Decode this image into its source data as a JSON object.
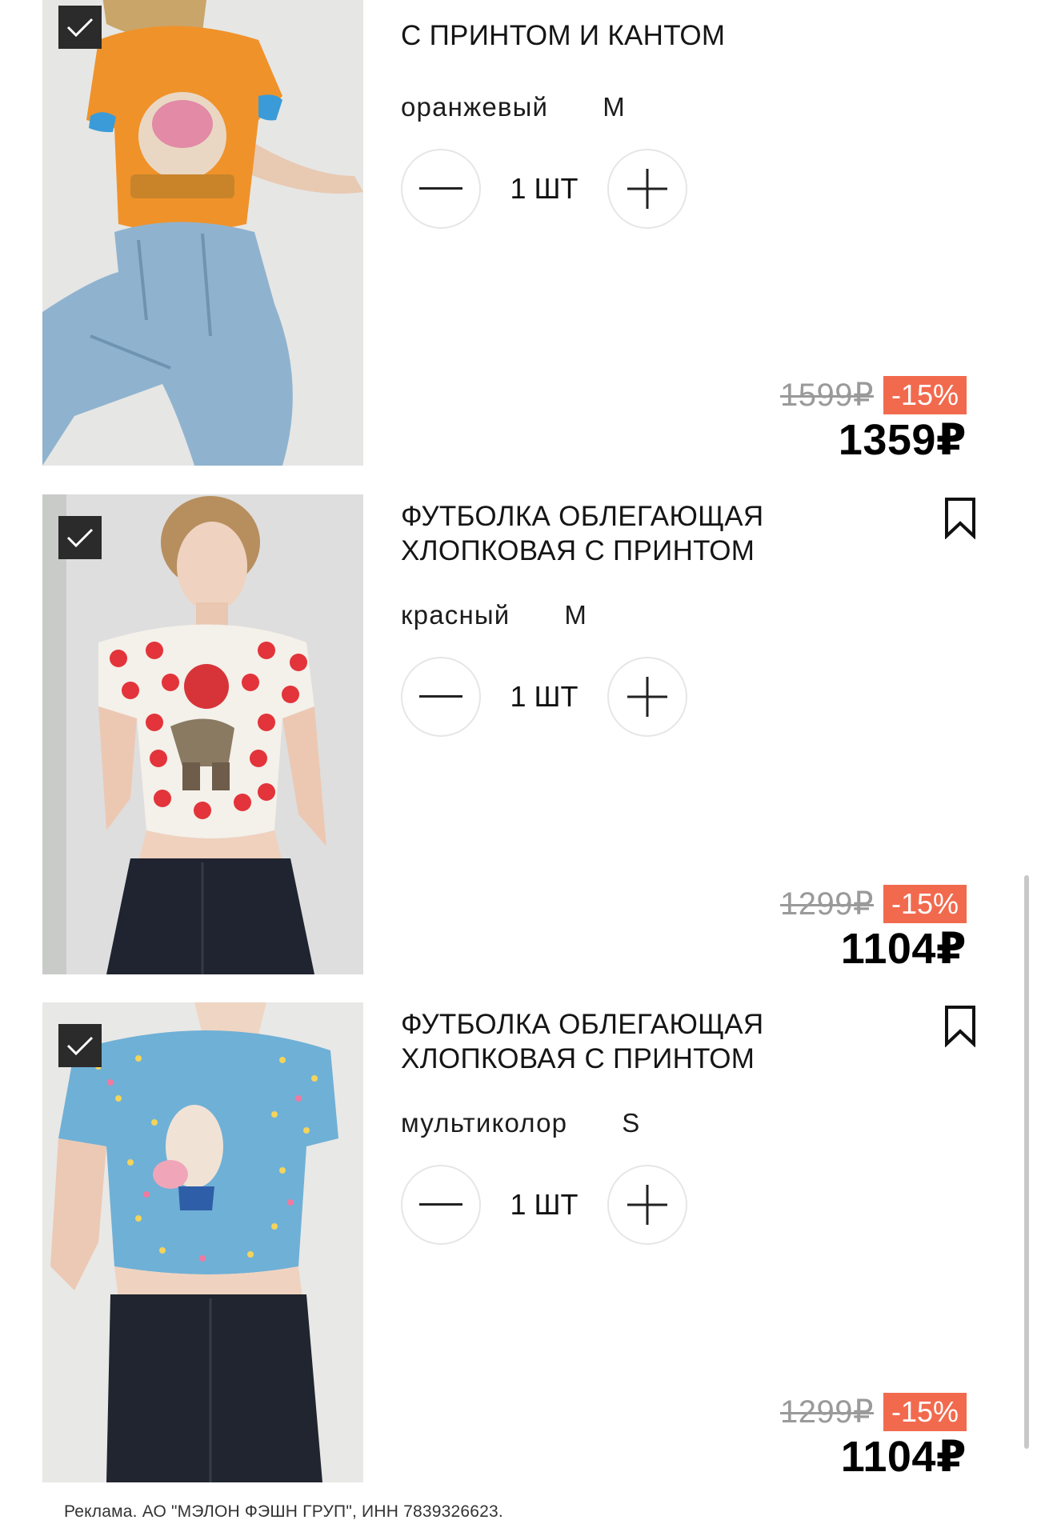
{
  "cart": {
    "items": [
      {
        "title": "С ПРИНТОМ И КАНТОМ",
        "color": "оранжевый",
        "size": "M",
        "quantity": "1 ШТ",
        "old_price": "1599₽",
        "discount": "-15%",
        "price": "1359₽",
        "selected": true,
        "photo_icon": "orange-tshirt-photo"
      },
      {
        "title": "ФУТБОЛКА ОБЛЕГАЮЩАЯ ХЛОПКОВАЯ С ПРИНТОМ",
        "color": "красный",
        "size": "M",
        "quantity": "1 ШТ",
        "old_price": "1299₽",
        "discount": "-15%",
        "price": "1104₽",
        "selected": true,
        "photo_icon": "red-polka-dot-tshirt-photo"
      },
      {
        "title": "ФУТБОЛКА ОБЛЕГАЮЩАЯ ХЛОПКОВАЯ С ПРИНТОМ",
        "color": "мультиколор",
        "size": "S",
        "quantity": "1 ШТ",
        "old_price": "1299₽",
        "discount": "-15%",
        "price": "1104₽",
        "selected": true,
        "photo_icon": "blue-floral-tshirt-photo"
      }
    ]
  },
  "footer": {
    "ad_text": "Реклама. АО \"МЭЛОН ФЭШН ГРУП\", ИНН 7839326623."
  },
  "colors": {
    "discount_badge": "#f26a4e",
    "old_price": "#9a9a9a",
    "checkbox": "#2b2b2b",
    "text": "#111111"
  }
}
